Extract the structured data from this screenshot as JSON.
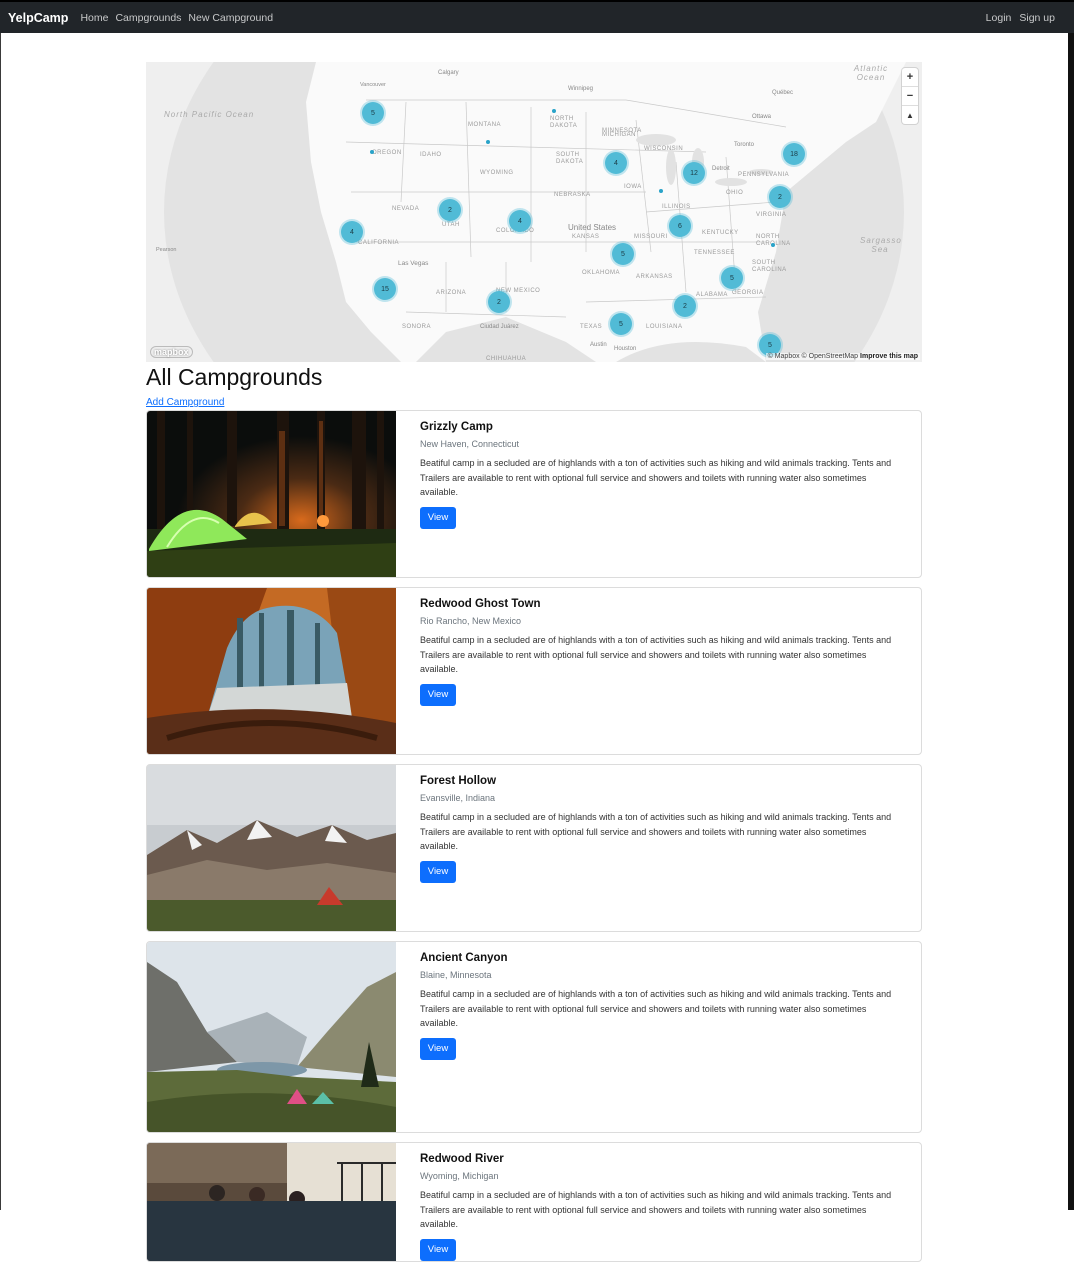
{
  "navbar": {
    "brand": "YelpCamp",
    "links": [
      "Home",
      "Campgrounds",
      "New Campground"
    ],
    "right_links": [
      "Login",
      "Sign up"
    ]
  },
  "map": {
    "attribution": "© Mapbox © OpenStreetMap",
    "improve": "Improve this map",
    "logo": "mapbox",
    "zoom_in": "+",
    "zoom_out": "−",
    "compass": "▲",
    "labels": {
      "north_pacific": "North Pacific Ocean",
      "atlantic": "Atlantic Ocean",
      "sargasso": "Sargasso Sea",
      "united_states": "United States",
      "las_vegas": "Las Vegas",
      "calgary": "Calgary",
      "winnipeg": "Winnipeg",
      "ottawa": "Ottawa",
      "toronto": "Toronto",
      "ciudad_juarez": "Ciudad Juárez",
      "austin": "Austin",
      "houston": "Houston",
      "quebec": "Québec",
      "detroit": "Detroit",
      "montana": "Montana",
      "idaho": "Idaho",
      "oregon": "Oregon",
      "wyoming": "Wyoming",
      "nevada": "Nevada",
      "utah": "Utah",
      "colorado": "Colorado",
      "california": "California",
      "arizona": "Arizona",
      "new_mexico": "New Mexico",
      "texas": "Texas",
      "oklahoma": "Oklahoma",
      "kansas": "Kansas",
      "nebraska": "Nebraska",
      "south_dakota": "South Dakota",
      "north_dakota": "North Dakota",
      "minnesota": "Minnesota",
      "iowa": "Iowa",
      "missouri": "Missouri",
      "illinois": "Illinois",
      "wisconsin": "Wisconsin",
      "ohio": "Ohio",
      "kentucky": "Kentucky",
      "tennessee": "Tennessee",
      "arkansas": "Arkansas",
      "louisiana": "Louisiana",
      "alabama": "Alabama",
      "georgia": "Georgia",
      "virginia": "Virginia",
      "pennsylvania": "Pennsylvania",
      "north_carolina": "North Carolina",
      "south_carolina": "South Carolina",
      "michigan": "Michigan",
      "sonora": "Sonora",
      "chihuahua": "Chihuahua",
      "pearson": "Pearson",
      "vancouver": "Vancouver"
    },
    "clusters": [
      "5",
      "4",
      "12",
      "18",
      "2",
      "2",
      "4",
      "4",
      "6",
      "5",
      "5",
      "15",
      "2",
      "2",
      "5",
      "5"
    ]
  },
  "page": {
    "title": "All Campgrounds",
    "add_link": "Add Campground"
  },
  "campgrounds": [
    {
      "title": "Grizzly Camp",
      "location": "New Haven, Connecticut",
      "description": "Beatiful camp in a secluded are of highlands with a ton of activities such as hiking and wild animals tracking. Tents and Trailers are available to rent with optional full service and showers and toilets with running water also sometimes available.",
      "button": "View"
    },
    {
      "title": "Redwood Ghost Town",
      "location": "Rio Rancho, New Mexico",
      "description": "Beatiful camp in a secluded are of highlands with a ton of activities such as hiking and wild animals tracking. Tents and Trailers are available to rent with optional full service and showers and toilets with running water also sometimes available.",
      "button": "View"
    },
    {
      "title": "Forest Hollow",
      "location": "Evansville, Indiana",
      "description": "Beatiful camp in a secluded are of highlands with a ton of activities such as hiking and wild animals tracking. Tents and Trailers are available to rent with optional full service and showers and toilets with running water also sometimes available.",
      "button": "View"
    },
    {
      "title": "Ancient Canyon",
      "location": "Blaine, Minnesota",
      "description": "Beatiful camp in a secluded are of highlands with a ton of activities such as hiking and wild animals tracking. Tents and Trailers are available to rent with optional full service and showers and toilets with running water also sometimes available.",
      "button": "View"
    },
    {
      "title": "Redwood River",
      "location": "Wyoming, Michigan",
      "description": "Beatiful camp in a secluded are of highlands with a ton of activities such as hiking and wild animals tracking. Tents and Trailers are available to rent with optional full service and showers and toilets with running water also sometimes available.",
      "button": "View"
    }
  ],
  "colors": {
    "navbar_bg": "#212529",
    "primary": "#0d6efd",
    "cluster": "#51bbd6"
  }
}
